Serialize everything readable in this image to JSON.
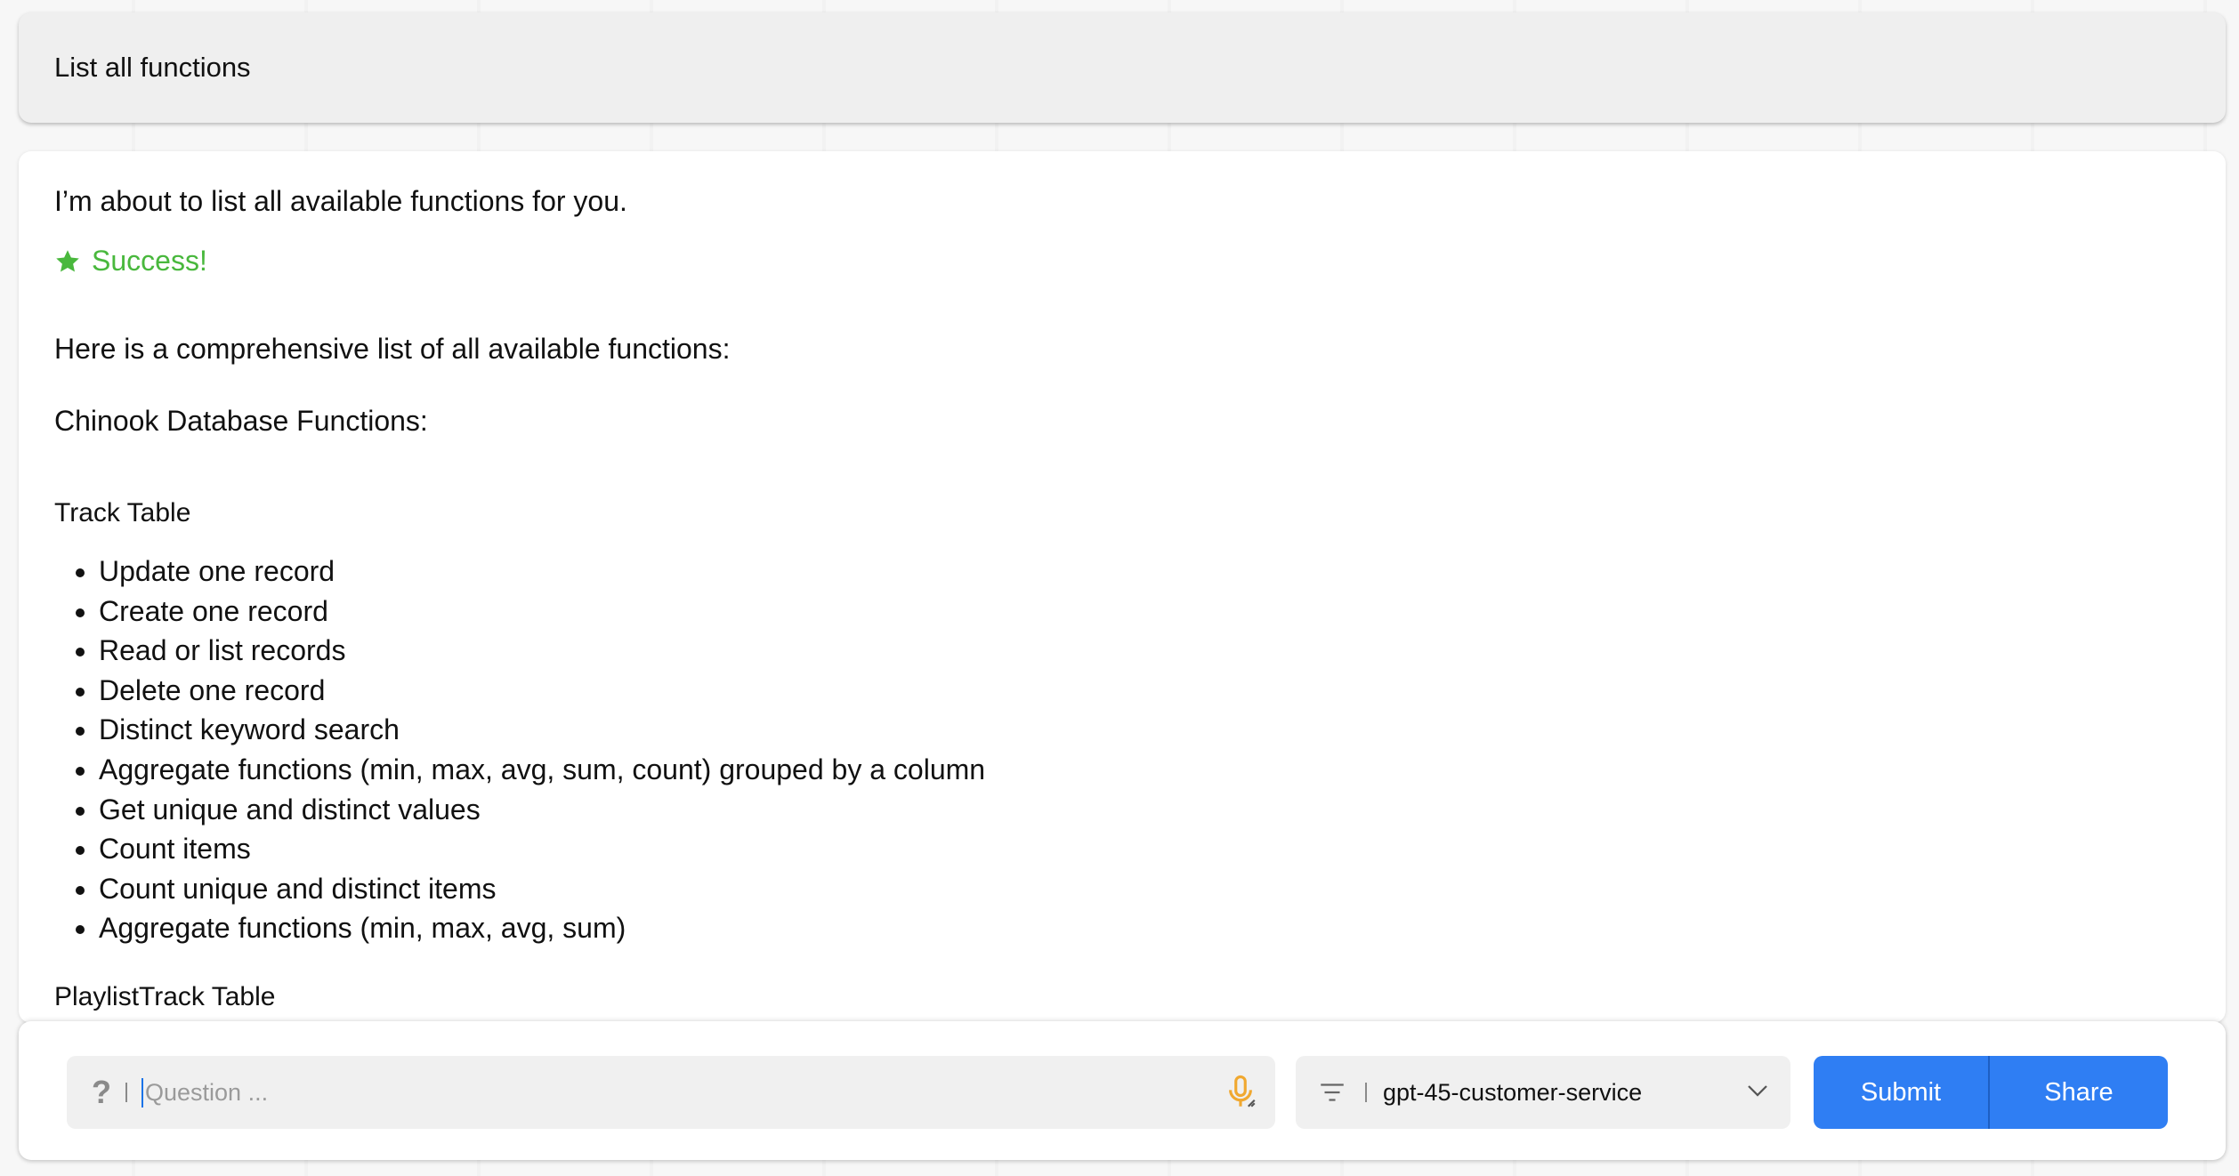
{
  "user_message": "List all functions",
  "answer": {
    "intro": "I’m about to list all available functions for you.",
    "status": "Success!",
    "summary": "Here is a comprehensive list of all available functions:",
    "database_heading": "Chinook Database Functions:",
    "sections": [
      {
        "title": "Track Table",
        "items": [
          "Update one record",
          "Create one record",
          "Read or list records",
          "Delete one record",
          "Distinct keyword search",
          "Aggregate functions (min, max, avg, sum, count) grouped by a column",
          "Get unique and distinct values",
          "Count items",
          "Count unique and distinct items",
          "Aggregate functions (min, max, avg, sum)"
        ]
      },
      {
        "title": "PlaylistTrack Table"
      }
    ]
  },
  "input_bar": {
    "question_icon": "?",
    "question_placeholder": "Question ...",
    "mic_icon": "microphone-icon",
    "model_value": "gpt-45-customer-service",
    "submit_label": "Submit",
    "share_label": "Share"
  },
  "colors": {
    "success": "#49b83d",
    "primary_button": "#2f7ef3",
    "mic": "#f0a830"
  }
}
